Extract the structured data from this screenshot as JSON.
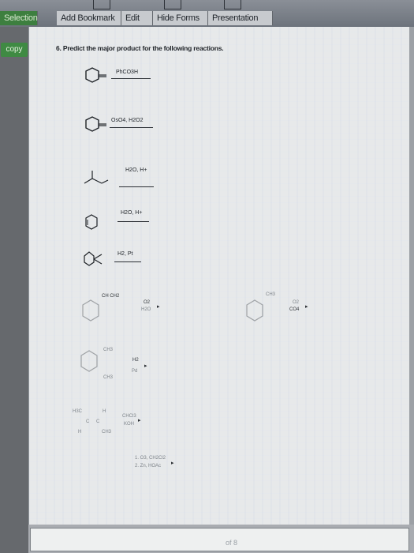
{
  "toolbar": {
    "menu": {
      "selection": "Selection",
      "add_bookmark": "Add Bookmark",
      "edit": "Edit",
      "hide_forms": "Hide Forms",
      "presentation": "Presentation"
    }
  },
  "sidebar": {
    "copy_label": "copy"
  },
  "document": {
    "question": "6. Predict the major product for the following reactions.",
    "reactions": [
      {
        "reagent": "PhCO3H"
      },
      {
        "reagent": "OsO4, H2O2"
      },
      {
        "reagent": "H2O, H+"
      },
      {
        "reagent": "H2O, H+"
      },
      {
        "reagent": "H2, Pt"
      },
      {
        "substituents": "CH  CH2",
        "reagent_top": "O2",
        "reagent_bottom": "H2O"
      },
      {
        "substituent": "CH3",
        "reagent_top": "O2",
        "reagent_bottom": "CO4"
      },
      {
        "top": "CH3",
        "bottom": "CH3",
        "reagent_top": "H2",
        "reagent_bottom": "Pd"
      },
      {
        "labels": [
          "H3C",
          "H",
          "C",
          "C",
          "H",
          "CH3"
        ],
        "reagent_top": "CHCl3",
        "reagent_bottom": "KOH"
      },
      {
        "reagent_top": "1. O3, CH2Cl2",
        "reagent_bottom": "2. Zn, HOAc"
      }
    ]
  },
  "footer": {
    "page_indicator": "of 8"
  }
}
